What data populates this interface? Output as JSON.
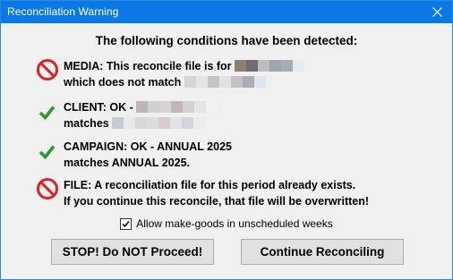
{
  "window": {
    "title": "Reconciliation Warning",
    "close_icon": "close-icon"
  },
  "heading": "The following conditions have been detected:",
  "conditions": [
    {
      "status": "error",
      "icon": "prohibited-icon",
      "line1": "MEDIA: This reconcile file is for ",
      "line2": "which does not match "
    },
    {
      "status": "ok",
      "icon": "checkmark-icon",
      "line1": "CLIENT: OK - ",
      "line2": "matches "
    },
    {
      "status": "ok",
      "icon": "checkmark-icon",
      "line1": "CAMPAIGN: OK - ANNUAL 2025",
      "line2": "matches ANNUAL 2025."
    },
    {
      "status": "error",
      "icon": "prohibited-icon",
      "line1": "FILE: A reconciliation file for this period already exists.",
      "line2": "If you continue this reconcile, that file will be overwritten!"
    }
  ],
  "checkbox": {
    "label": "Allow make-goods in unscheduled weeks",
    "checked": true
  },
  "buttons": {
    "stop_label": "STOP! Do NOT Proceed!",
    "continue_label": "Continue Reconciling"
  },
  "colors": {
    "titlebar": "#0a79e6",
    "error": "#d9232a",
    "ok": "#2e9b2e",
    "dialog_bg": "#f0f0f0",
    "button_bg": "#e1e1e1"
  }
}
